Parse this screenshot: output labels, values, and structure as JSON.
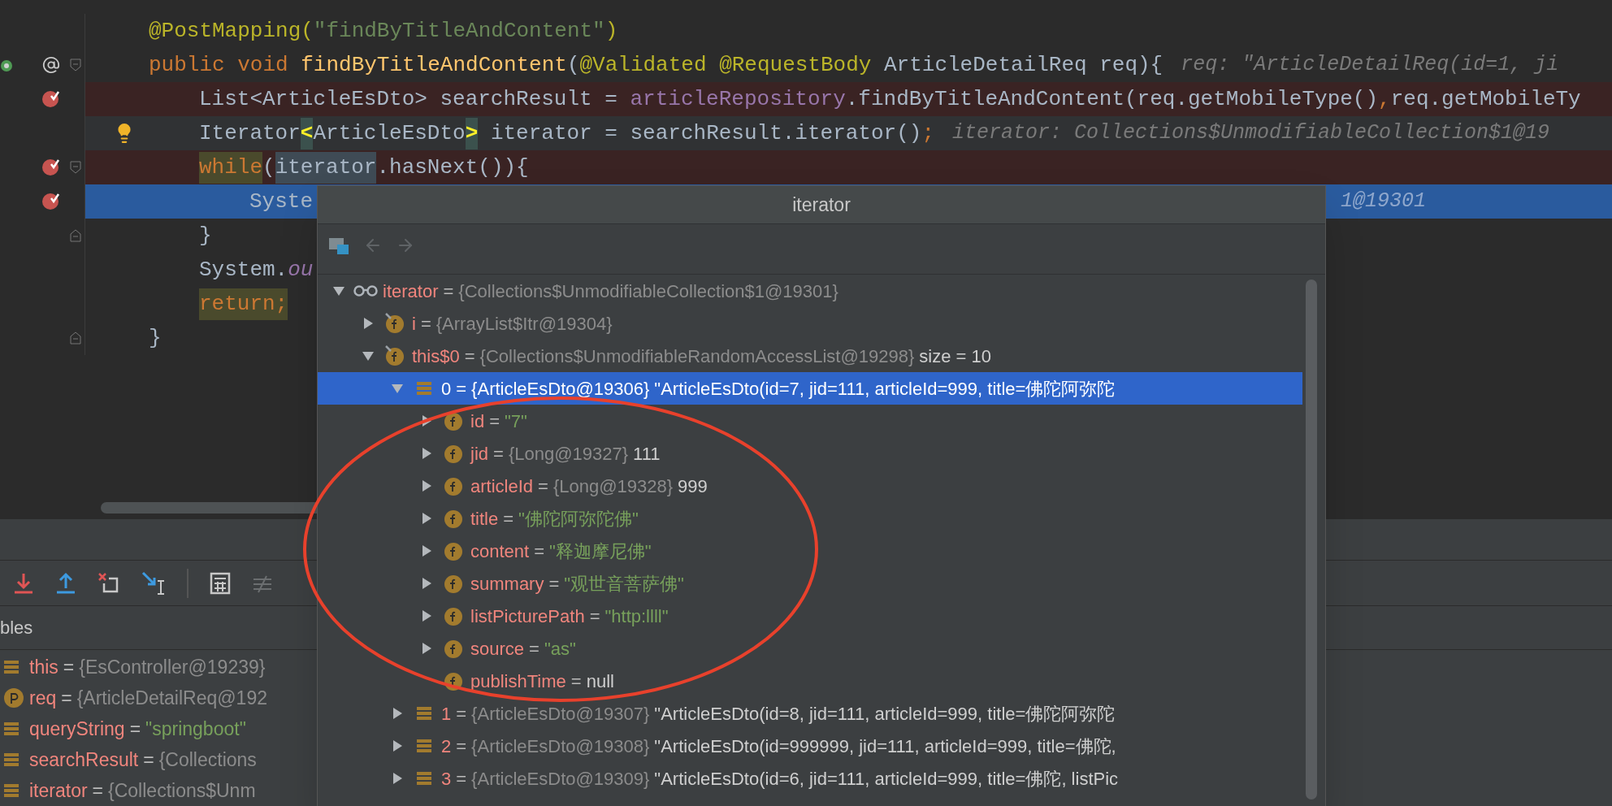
{
  "editor": {
    "lines": [
      {
        "kind": "plain",
        "tokens": [
          {
            "text": "@PostMapping(",
            "kind": "annotation"
          },
          {
            "text": "\"findByTitleAndContent\"",
            "kind": "string"
          },
          {
            "text": ")",
            "kind": "annotation"
          }
        ]
      },
      {
        "kind": "plain",
        "gutter": [
          {
            "kind": "run"
          },
          {
            "kind": "mapping"
          },
          {
            "kind": "fold_start"
          }
        ],
        "tokens": [
          {
            "text": "public void ",
            "kind": "keyword"
          },
          {
            "text": "findByTitleAndContent",
            "kind": "method"
          },
          {
            "text": "(",
            "kind": "plain"
          },
          {
            "text": "@Validated @RequestBody ",
            "kind": "annotation"
          },
          {
            "text": "ArticleDetailReq req){",
            "kind": "plain"
          },
          {
            "text": "req: \"ArticleDetailReq(id=1, ji",
            "kind": "hint"
          }
        ],
        "children": [
          {
            "kind": "breakpoint",
            "gutter": [
              {
                "kind": "breakpoint"
              }
            ],
            "tokens": [
              {
                "text": "List<ArticleEsDto> searchResult = ",
                "kind": "plain"
              },
              {
                "text": "articleRepository",
                "kind": "field"
              },
              {
                "text": ".findByTitleAndContent(req.getMobileType()",
                "kind": "plain"
              },
              {
                "text": ",",
                "kind": "keyword"
              },
              {
                "text": "req.getMobileTy",
                "kind": "plain"
              }
            ]
          },
          {
            "kind": "caret",
            "gutter": [
              {
                "kind": "bulb"
              }
            ],
            "tokens": [
              {
                "text": "Iterator",
                "kind": "plain"
              },
              {
                "text": "<",
                "kind": "bracket"
              },
              {
                "text": "ArticleEsDto",
                "kind": "plain"
              },
              {
                "text": ">",
                "kind": "bracket"
              },
              {
                "text": " iterator = searchResult.iterator()",
                "kind": "plain"
              },
              {
                "text": ";",
                "kind": "keyword"
              },
              {
                "text": "iterator: Collections$UnmodifiableCollection$1@19",
                "kind": "hint"
              }
            ]
          },
          {
            "kind": "breakpoint",
            "gutter": [
              {
                "kind": "breakpoint"
              },
              {
                "kind": "fold_start"
              }
            ],
            "tokens": [
              {
                "text": "while",
                "kind": "keyword_marked"
              },
              {
                "text": "(",
                "kind": "plain"
              },
              {
                "text": "iterator",
                "kind": "plain_marked"
              },
              {
                "text": ".hasNext()){",
                "kind": "plain"
              }
            ],
            "children": [
              {
                "kind": "current",
                "gutter": [
                  {
                    "kind": "breakpoint"
                  }
                ],
                "tokens": [
                  {
                    "text": "Syste",
                    "kind": "plain"
                  },
                  {
                    "text": "1@19301",
                    "kind": "hint_far"
                  }
                ]
              }
            ]
          },
          {
            "kind": "plain",
            "gutter": [
              {
                "kind": "fold_end"
              }
            ],
            "tokens": [
              {
                "text": "}",
                "kind": "plain"
              }
            ]
          },
          {
            "kind": "plain",
            "tokens": [
              {
                "text": "System.",
                "kind": "plain"
              },
              {
                "text": "ou",
                "kind": "static_field"
              }
            ]
          },
          {
            "kind": "plain",
            "tokens": [
              {
                "text": "return;",
                "kind": "keyword_marked"
              }
            ]
          }
        ]
      },
      {
        "kind": "plain",
        "gutter": [
          {
            "kind": "fold_end"
          }
        ],
        "tokens": [
          {
            "text": "}",
            "kind": "plain"
          }
        ]
      }
    ]
  },
  "debug": {
    "section_label": "bles",
    "variables": [
      {
        "kind": "array",
        "name": "this",
        "sep": "=",
        "ref": "{EsController@19239}"
      },
      {
        "kind": "param",
        "name": "req",
        "sep": "=",
        "ref": "{ArticleDetailReq@192"
      },
      {
        "kind": "array",
        "name": "queryString",
        "sep": "=",
        "string": "\"springboot\""
      },
      {
        "kind": "array",
        "name": "searchResult",
        "sep": "=",
        "ref": "{Collections"
      },
      {
        "kind": "array",
        "name": "iterator",
        "sep": "=",
        "ref": "{Collections$Unm"
      }
    ]
  },
  "popup": {
    "title": "iterator",
    "tree": [
      {
        "kind": "watch",
        "name": "iterator",
        "sep": "=",
        "ref": "{Collections$UnmodifiableCollection$1@19301}",
        "expanded": true,
        "selected": false,
        "children": [
          {
            "kind": "field_marked",
            "name": "i",
            "sep": "=",
            "ref": "{ArrayList$Itr@19304}",
            "expanded": false,
            "selected": false
          },
          {
            "kind": "field_marked",
            "name": "this$0",
            "sep": "=",
            "ref": "{Collections$UnmodifiableRandomAccessList@19298}",
            "value": "size = 10",
            "expanded": true,
            "selected": false,
            "children": [
              {
                "kind": "array",
                "name": "0",
                "sep": "=",
                "ref": "{ArticleEsDto@19306}",
                "value": "\"ArticleEsDto(id=7, jid=111, articleId=999, title=佛陀阿弥陀",
                "expanded": true,
                "selected": true,
                "children": [
                  {
                    "kind": "field",
                    "name": "id",
                    "sep": "=",
                    "string": "\"7\"",
                    "expanded": false,
                    "selected": false
                  },
                  {
                    "kind": "field",
                    "name": "jid",
                    "sep": "=",
                    "ref": "{Long@19327}",
                    "value": "111",
                    "expanded": false,
                    "selected": false
                  },
                  {
                    "kind": "field",
                    "name": "articleId",
                    "sep": "=",
                    "ref": "{Long@19328}",
                    "value": "999",
                    "expanded": false,
                    "selected": false
                  },
                  {
                    "kind": "field",
                    "name": "title",
                    "sep": "=",
                    "string": "\"佛陀阿弥陀佛\"",
                    "expanded": false,
                    "selected": false
                  },
                  {
                    "kind": "field",
                    "name": "content",
                    "sep": "=",
                    "string": "\"释迦摩尼佛\"",
                    "expanded": false,
                    "selected": false
                  },
                  {
                    "kind": "field",
                    "name": "summary",
                    "sep": "=",
                    "string": "\"观世音菩萨佛\"",
                    "expanded": false,
                    "selected": false
                  },
                  {
                    "kind": "field",
                    "name": "listPicturePath",
                    "sep": "=",
                    "string": "\"http:llll\"",
                    "expanded": false,
                    "selected": false
                  },
                  {
                    "kind": "field",
                    "name": "source",
                    "sep": "=",
                    "string": "\"as\"",
                    "expanded": false,
                    "selected": false
                  },
                  {
                    "kind": "field",
                    "name": "publishTime",
                    "sep": "=",
                    "value": "null",
                    "selected": false
                  }
                ]
              },
              {
                "kind": "array",
                "name": "1",
                "sep": "=",
                "ref": "{ArticleEsDto@19307}",
                "value": "\"ArticleEsDto(id=8, jid=111, articleId=999, title=佛陀阿弥陀",
                "expanded": false,
                "selected": false
              },
              {
                "kind": "array",
                "name": "2",
                "sep": "=",
                "ref": "{ArticleEsDto@19308}",
                "value": "\"ArticleEsDto(id=999999, jid=111, articleId=999, title=佛陀,",
                "expanded": false,
                "selected": false
              },
              {
                "kind": "array",
                "name": "3",
                "sep": "=",
                "ref": "{ArticleEsDto@19309}",
                "value": "\"ArticleEsDto(id=6, jid=111, articleId=999, title=佛陀, listPic",
                "expanded": false,
                "selected": false
              }
            ]
          }
        ]
      }
    ]
  }
}
